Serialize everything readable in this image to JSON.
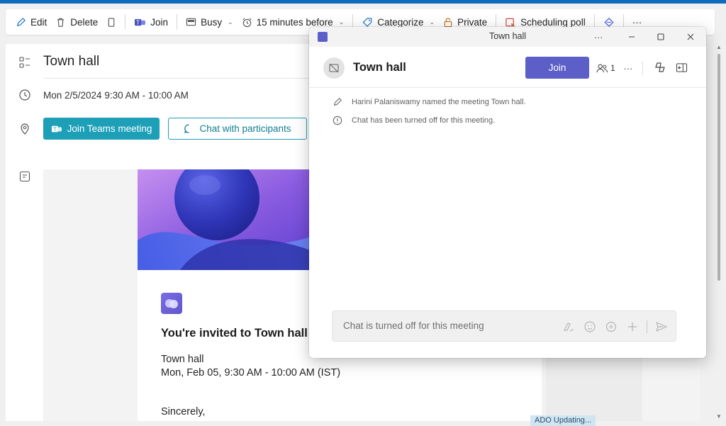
{
  "toolbar": {
    "edit": "Edit",
    "delete": "Delete",
    "join": "Join",
    "busy": "Busy",
    "reminder": "15 minutes before",
    "categorize": "Categorize",
    "private": "Private",
    "scheduling_poll": "Scheduling poll",
    "more": "···"
  },
  "event": {
    "title": "Town hall",
    "datetime": "Mon 2/5/2024 9:30 AM - 10:00 AM",
    "join_teams": "Join Teams meeting",
    "chat_participants": "Chat with participants"
  },
  "invite": {
    "heading": "You're invited to Town hall",
    "line1": "Town hall",
    "line2": "Mon, Feb 05, 9:30 AM - 10:00 AM (IST)",
    "closing": "Sincerely,"
  },
  "background": {
    "partial_label": "ADO Updating..."
  },
  "popup": {
    "window_title": "Town hall",
    "chat_name": "Town hall",
    "join": "Join",
    "participant_count": "1",
    "more": "···",
    "messages": [
      "Harini Palaniswamy named the meeting Town hall.",
      "Chat has been turned off for this meeting."
    ],
    "compose_placeholder": "Chat is turned off for this meeting"
  },
  "colors": {
    "outlook_blue": "#0f6cbd",
    "teams_join_cyan": "#1d9fb7",
    "teams_purple": "#5b5fc7"
  }
}
